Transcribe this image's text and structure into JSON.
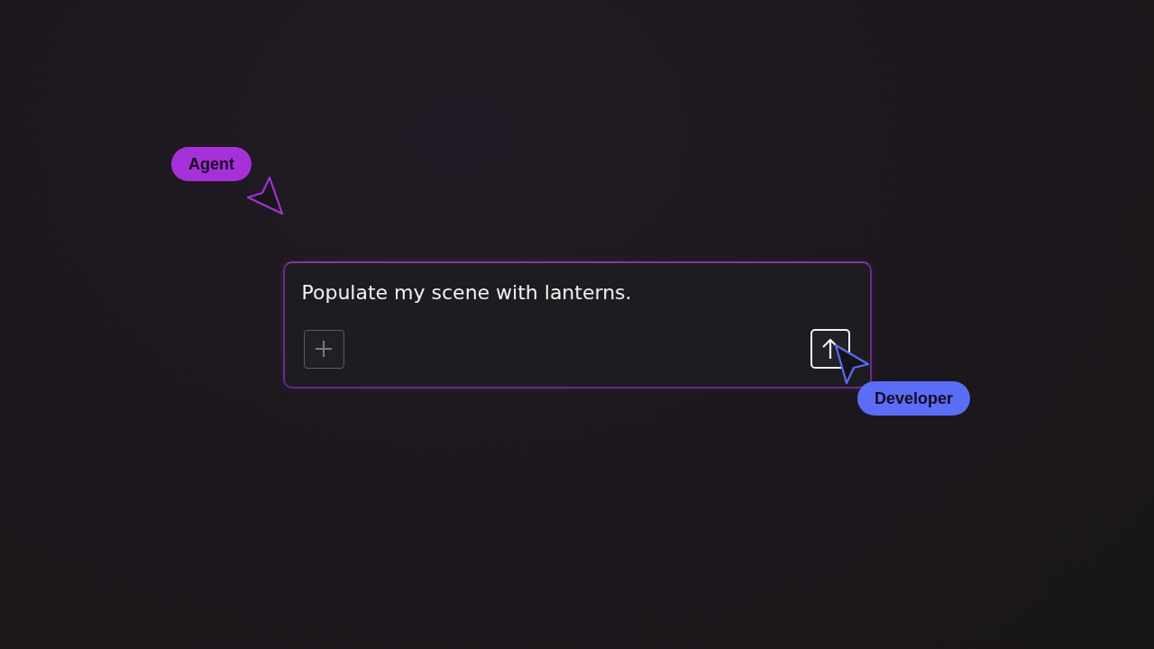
{
  "prompt": {
    "value": "Populate my scene with lanterns."
  },
  "cursors": [
    {
      "name": "Agent",
      "color": "#a631d8"
    },
    {
      "name": "Developer",
      "color": "#5b6cf6"
    }
  ]
}
